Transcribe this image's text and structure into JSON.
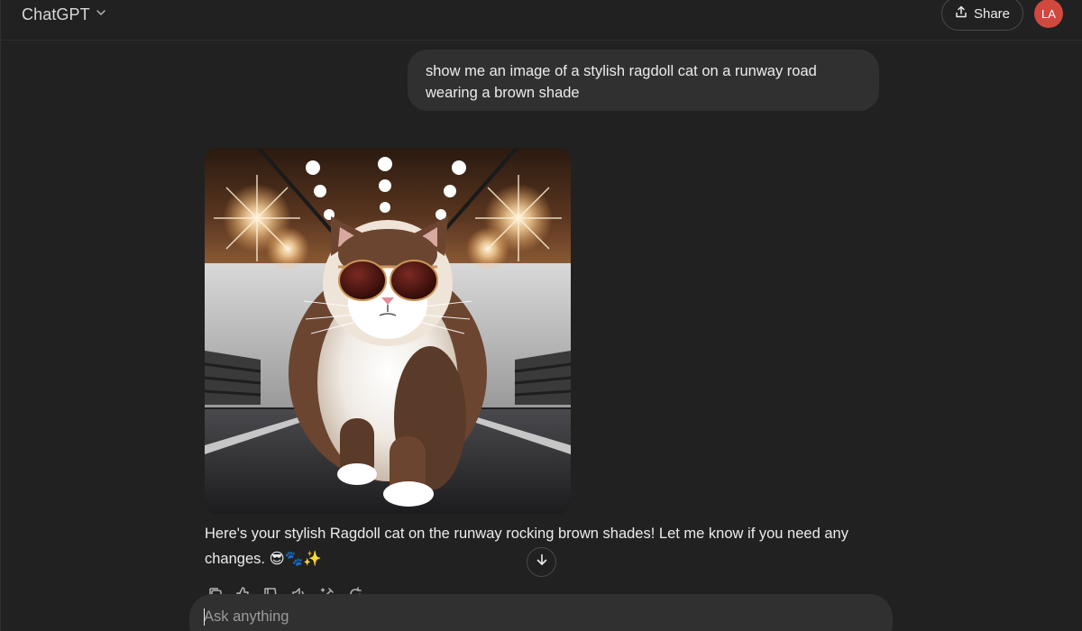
{
  "header": {
    "model_name": "ChatGPT",
    "share_label": "Share",
    "avatar_initials": "LA"
  },
  "conversation": {
    "user_message": "show me an image of a stylish ragdoll cat on a runway road wearing a brown shade",
    "assistant_text": "Here's your stylish Ragdoll cat on the runway rocking brown shades! Let me know if you need any changes. 😎🐾✨"
  },
  "composer": {
    "placeholder": "Ask anything"
  },
  "colors": {
    "background": "#212121",
    "bubble": "#303030",
    "avatar": "#d1483f"
  }
}
